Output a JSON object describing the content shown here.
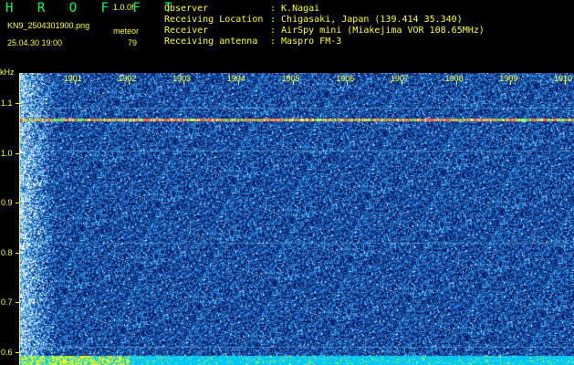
{
  "header": {
    "app_name": "H R O F F T",
    "version": "1.0.0f",
    "filename": "KN9_2504301900.png",
    "datetime": "25.04.30 19:00",
    "event_label": "meteor",
    "event_count": "79",
    "observer_label": "Observer",
    "observer_value": ": K.Nagai",
    "location_label": "Receiving Location",
    "location_value": ": Chigasaki, Japan (139.414 35.340)",
    "receiver_label": "Receiver",
    "receiver_value": ": AirSpy mini (Miakejima VOR 108.65MHz)",
    "antenna_label": "Receiving antenna",
    "antenna_value": ": Maspro FM-3"
  },
  "colors": {
    "text": "#ffff2a",
    "title": "#00ff66",
    "background": "#000000",
    "spectrogram_low": "#0a1a7a",
    "spectrogram_mid": "#1f6fff",
    "spectrogram_high": "#ffffff",
    "carrier_line": "#ff5a5a",
    "bottom_strip": "#00c8ff",
    "bottom_marks": "#ffff00"
  },
  "chart_data": {
    "type": "heatmap",
    "title": "",
    "xlabel": "",
    "ylabel": "kHz",
    "x_ticks": [
      "1901",
      "1902",
      "1903",
      "1904",
      "1905",
      "1906",
      "1907",
      "1908",
      "1909",
      "1910"
    ],
    "x_range": [
      1900,
      1910
    ],
    "y_ticks": [
      "1.1",
      "1.0",
      "0.9",
      "0.8",
      "0.7",
      "0.6"
    ],
    "y_tick_values": [
      1.1,
      1.0,
      0.9,
      0.8,
      0.7,
      0.6
    ],
    "y_range": [
      0.574,
      1.161
    ],
    "carrier_frequency_khz": 1.067,
    "faint_lines_khz": [
      1.091,
      1.005,
      0.82,
      0.61
    ]
  }
}
